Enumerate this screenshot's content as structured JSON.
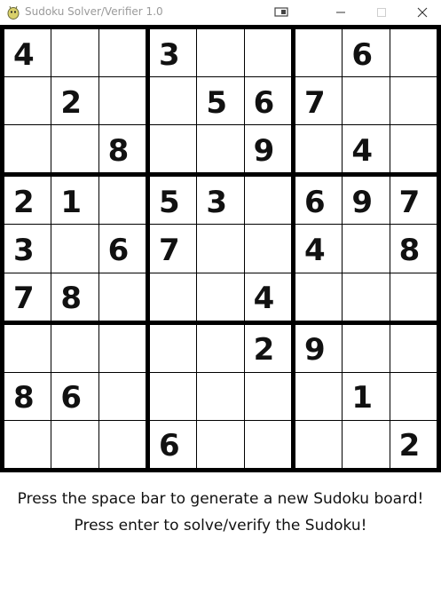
{
  "window": {
    "title": "Sudoku Solver/Verifier 1.0",
    "controls": {
      "minimize": "minimize",
      "maximize": "maximize",
      "close": "close"
    }
  },
  "board": [
    [
      4,
      0,
      0,
      3,
      0,
      0,
      0,
      6,
      0
    ],
    [
      0,
      2,
      0,
      0,
      5,
      6,
      7,
      0,
      0
    ],
    [
      0,
      0,
      8,
      0,
      0,
      9,
      0,
      4,
      0
    ],
    [
      2,
      1,
      0,
      5,
      3,
      0,
      6,
      9,
      7
    ],
    [
      3,
      0,
      6,
      7,
      0,
      0,
      4,
      0,
      8
    ],
    [
      7,
      8,
      0,
      0,
      0,
      4,
      0,
      0,
      0
    ],
    [
      0,
      0,
      0,
      0,
      0,
      2,
      9,
      0,
      0
    ],
    [
      8,
      6,
      0,
      0,
      0,
      0,
      0,
      1,
      0
    ],
    [
      0,
      0,
      0,
      6,
      0,
      0,
      0,
      0,
      2
    ]
  ],
  "instructions": {
    "line1": "Press the space bar to generate a new Sudoku board!",
    "line2": "Press enter to solve/verify the Sudoku!"
  }
}
